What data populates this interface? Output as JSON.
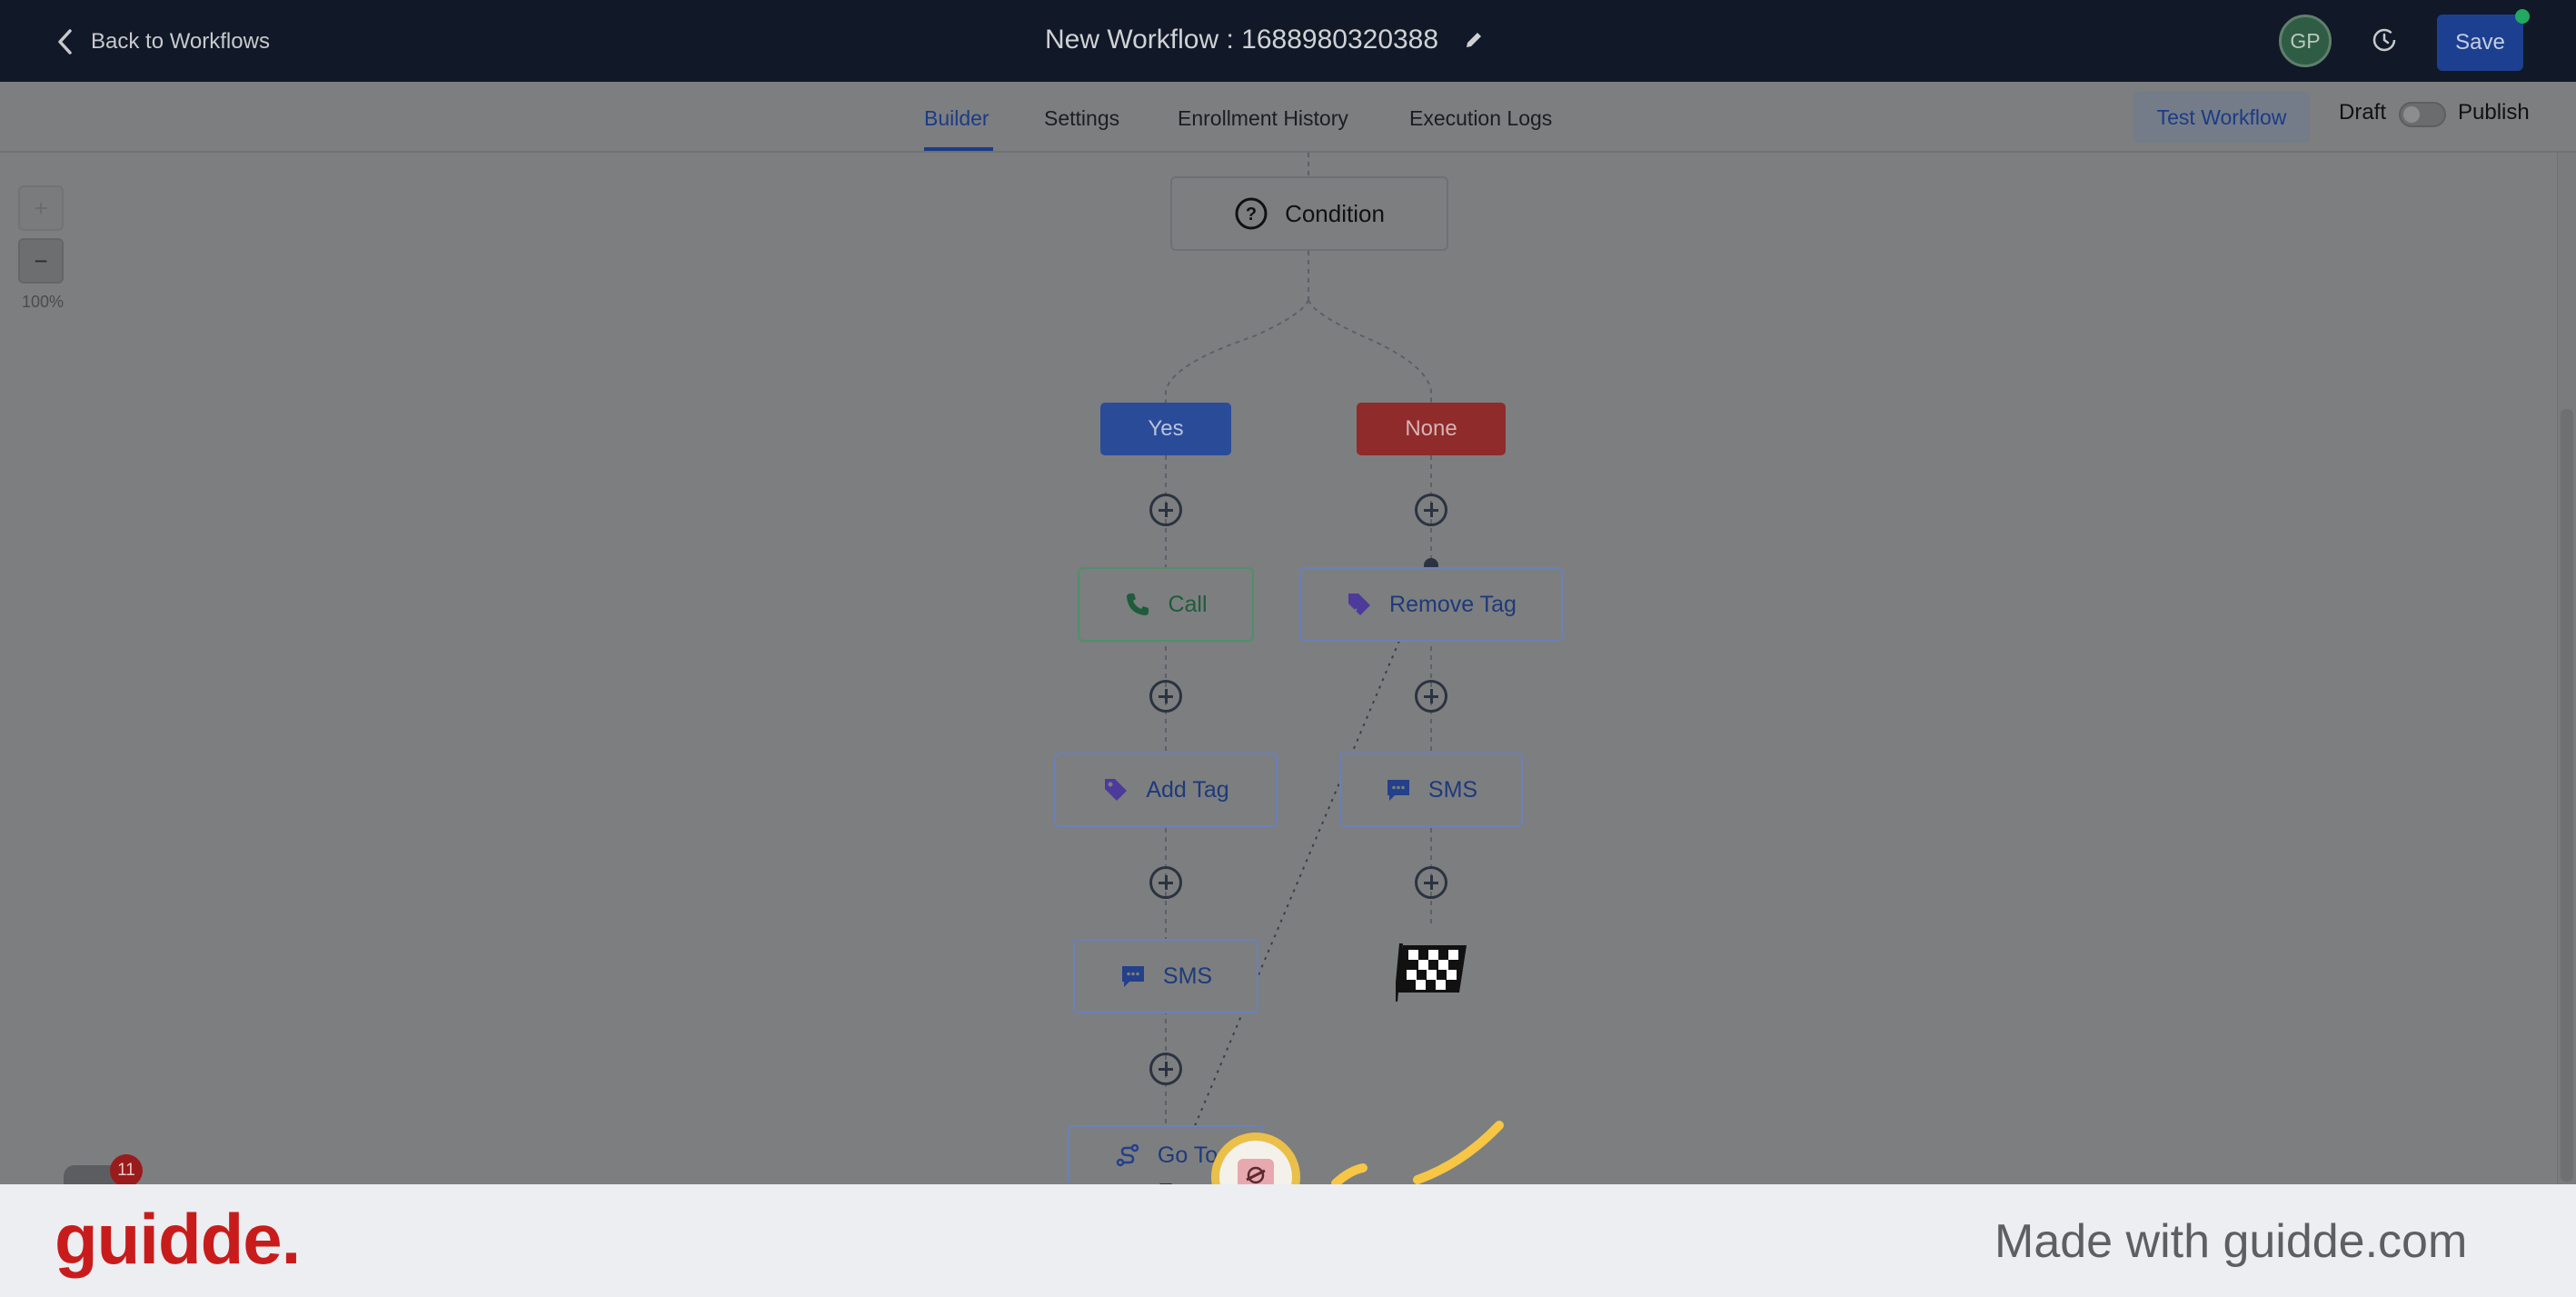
{
  "header": {
    "back_label": "Back to Workflows",
    "title": "New Workflow : 1688980320388",
    "avatar_initials": "GP",
    "save_label": "Save"
  },
  "tabs": [
    {
      "label": "Builder",
      "active": true
    },
    {
      "label": "Settings",
      "active": false
    },
    {
      "label": "Enrollment History",
      "active": false
    },
    {
      "label": "Execution Logs",
      "active": false
    }
  ],
  "actions": {
    "test_label": "Test Workflow",
    "draft_label": "Draft",
    "publish_label": "Publish",
    "published": false
  },
  "zoom": {
    "in_label": "+",
    "out_label": "−",
    "level": "100%"
  },
  "workflow": {
    "condition_label": "Condition",
    "branches": {
      "yes": "Yes",
      "none": "None"
    },
    "yes_steps": [
      "Call",
      "Add Tag",
      "SMS",
      "Go To"
    ],
    "none_steps": [
      "Remove Tag",
      "SMS"
    ]
  },
  "chat_widget": {
    "badge_count": "11"
  },
  "footer": {
    "brand": "guidde.",
    "made_with": "Made with guidde.com"
  },
  "colors": {
    "accent": "#1c3b86",
    "yes_branch": "#2a4b98",
    "none_branch": "#8f2b2b",
    "brand_red": "#c81c1c",
    "highlight": "#f6c644"
  }
}
